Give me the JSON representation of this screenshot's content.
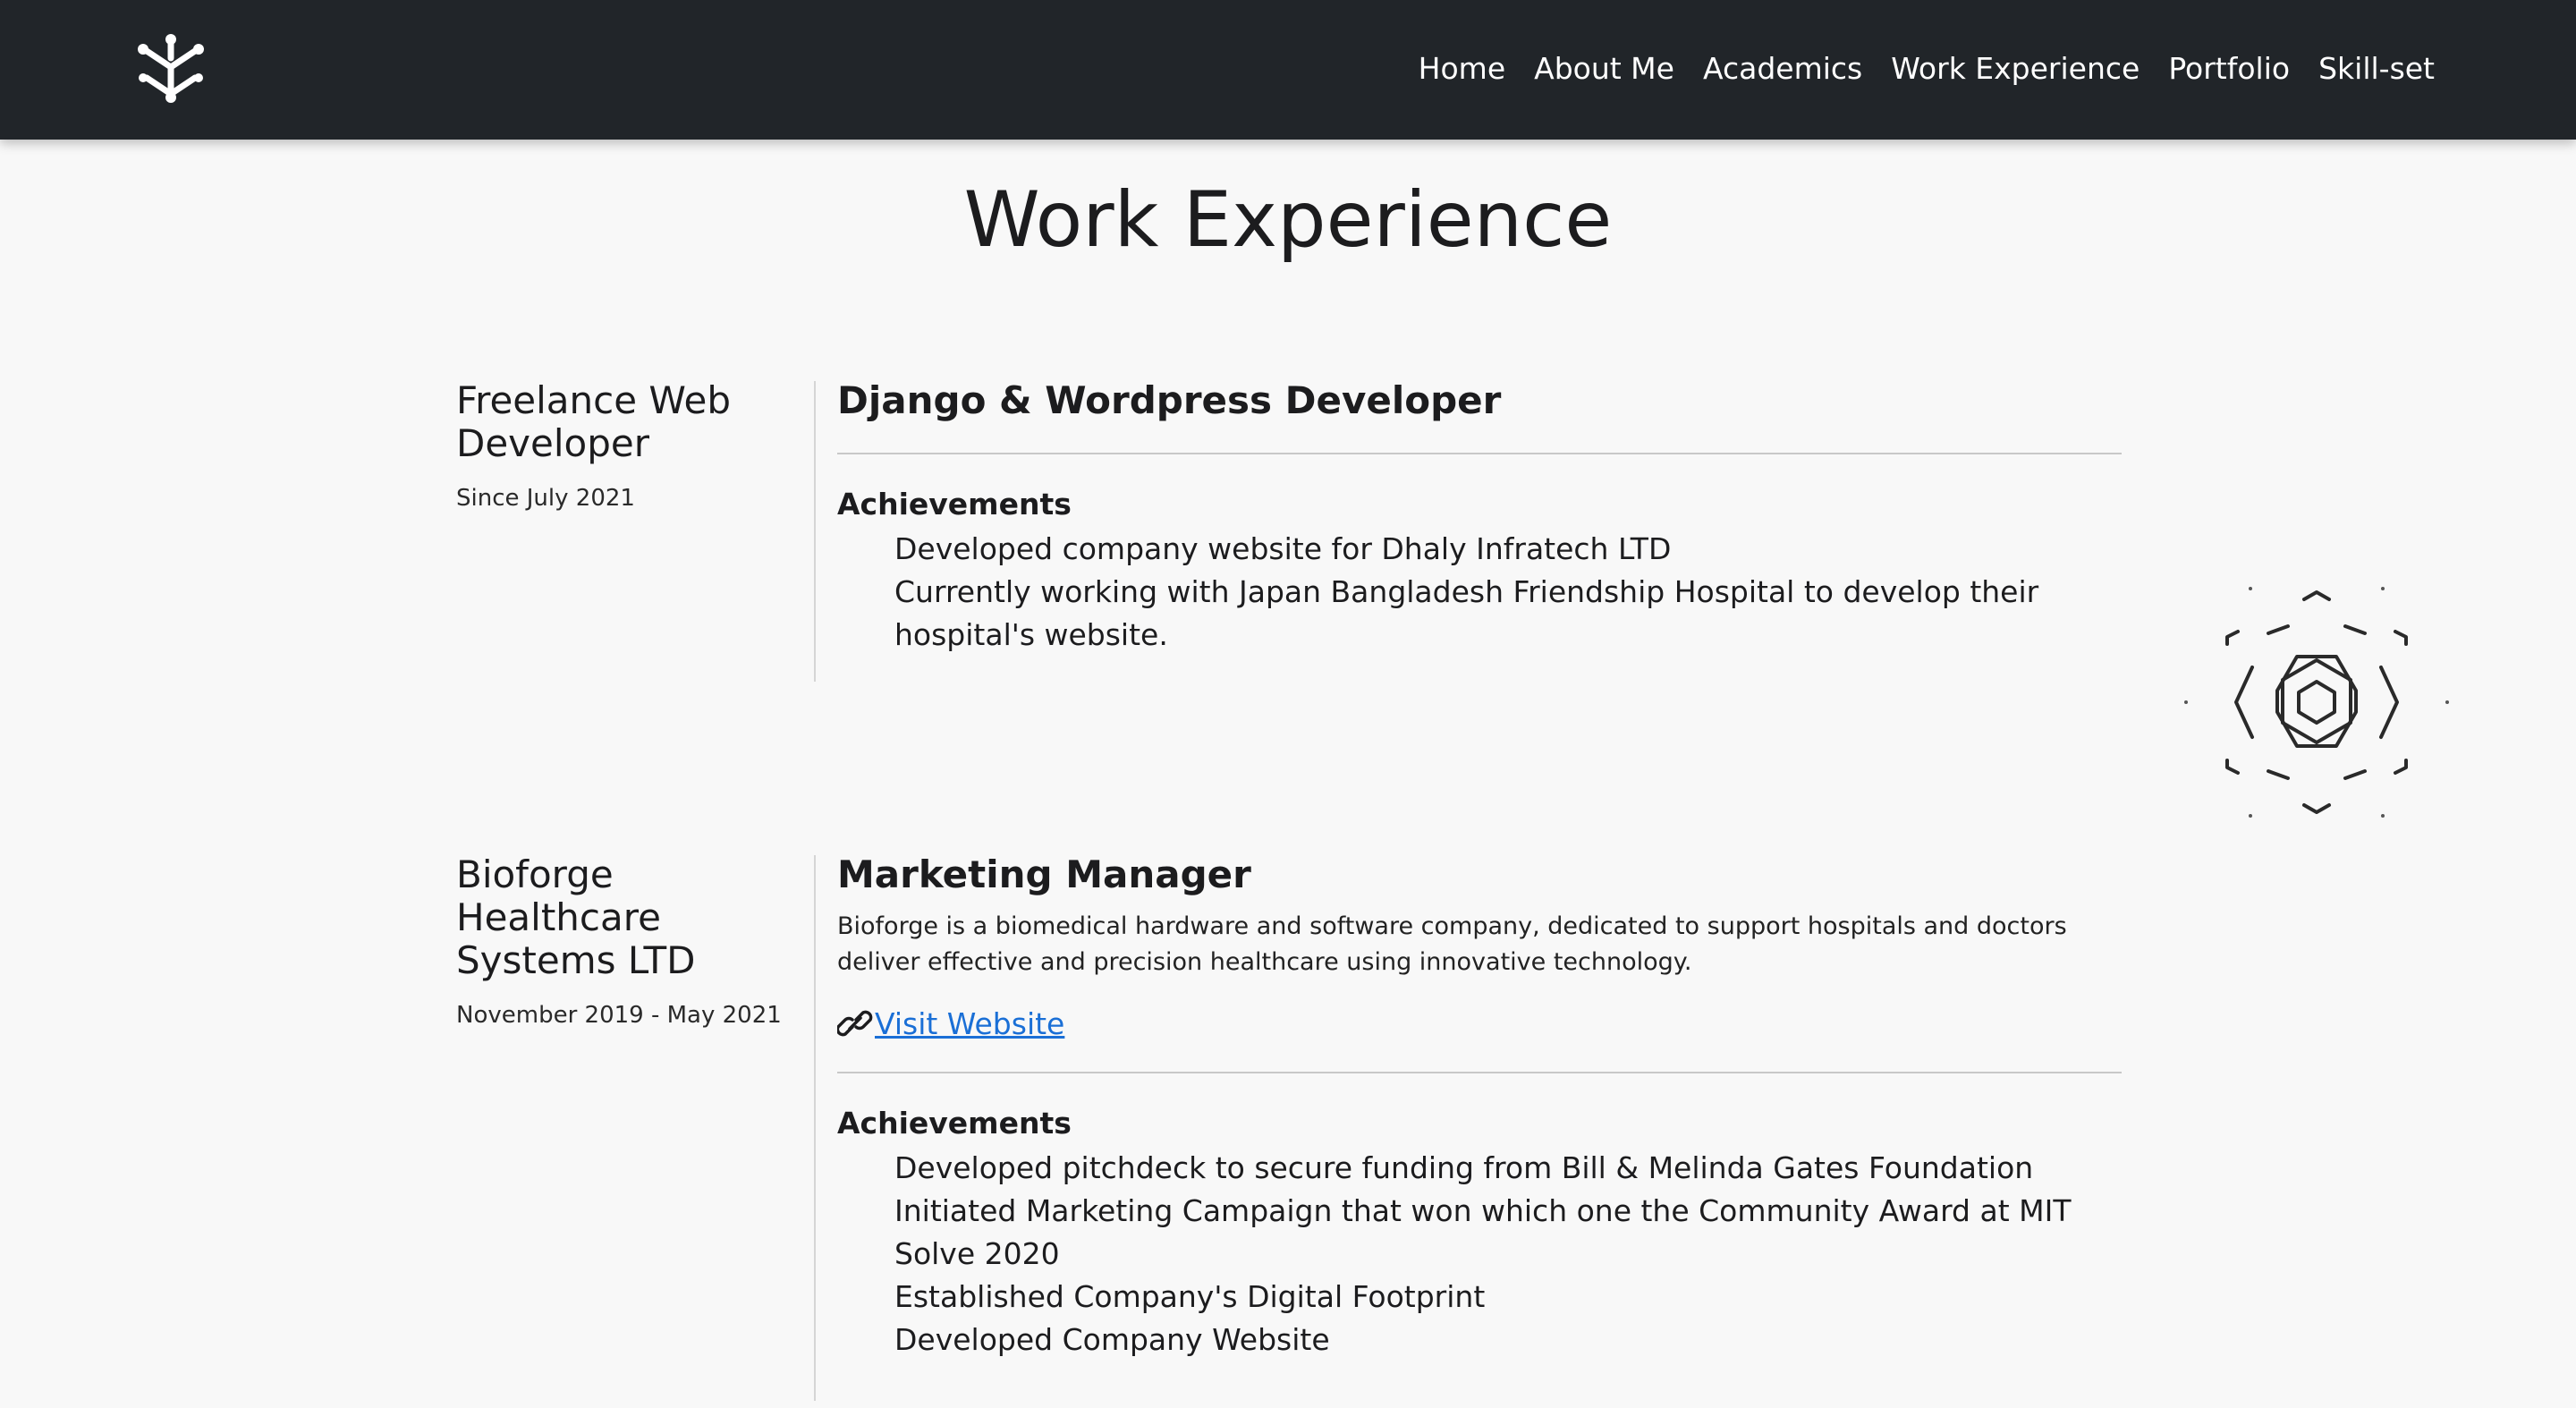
{
  "nav": {
    "links": [
      "Home",
      "About Me",
      "Academics",
      "Work Experience",
      "Portfolio",
      "Skill-set"
    ]
  },
  "page_title": "Work Experience",
  "jobs": [
    {
      "company": "Freelance Web Developer",
      "date": "Since July 2021",
      "role": "Django & Wordpress Developer",
      "achievements_title": "Achievements",
      "achievements": [
        "Developed company website for Dhaly Infratech LTD",
        "Currently working with Japan Bangladesh Friendship Hospital to develop their hospital's website."
      ]
    },
    {
      "company": "Bioforge Healthcare Systems LTD",
      "date": "November 2019 - May 2021",
      "role": "Marketing Manager",
      "description": "Bioforge is a biomedical hardware and software company, dedicated to support hospitals and doctors deliver effective and precision healthcare using innovative technology.",
      "link_label": "Visit Website",
      "achievements_title": "Achievements",
      "achievements": [
        "Developed pitchdeck to secure funding from Bill & Melinda Gates Foundation",
        "Initiated Marketing Campaign that won which one the Community Award at MIT Solve 2020",
        "Established Company's Digital Footprint",
        "Developed Company Website"
      ]
    }
  ],
  "colors": {
    "navbar_bg": "#212529",
    "page_bg": "#f8f8f8",
    "link": "#1a6fd6"
  },
  "icons": {
    "logo": "network-node-logo-icon",
    "link": "chain-link-icon",
    "emblem": "hexagon-emblem-icon"
  }
}
